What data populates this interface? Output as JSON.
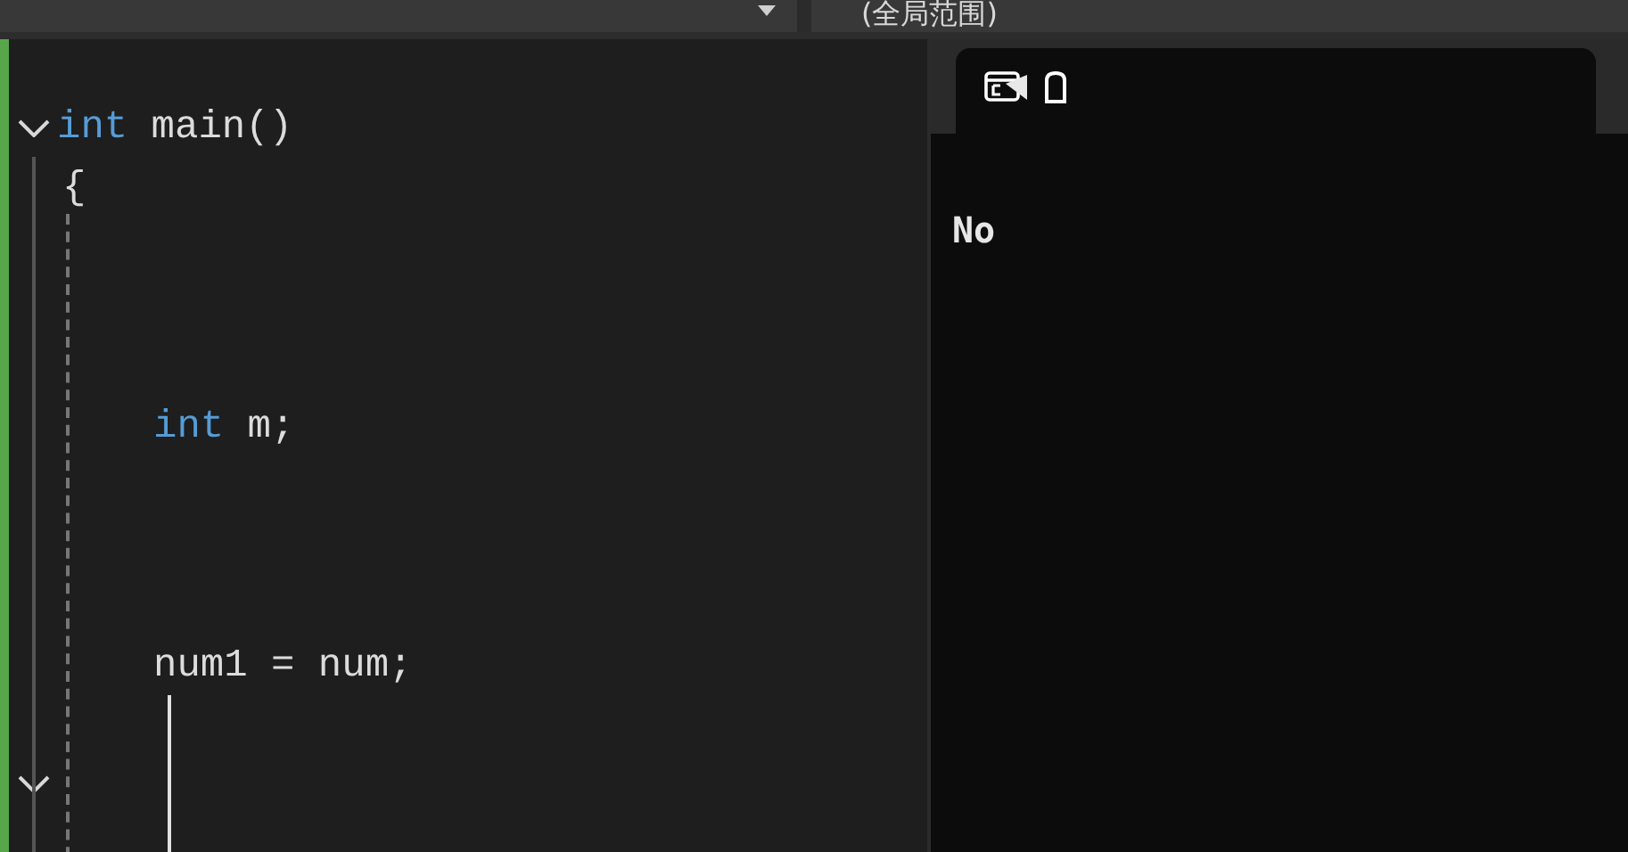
{
  "top_bar": {
    "scope_label": "(全局范围)"
  },
  "editor": {
    "lines": [
      {
        "fold": true,
        "tokens": [
          {
            "kind": "keyword",
            "text": "int"
          },
          {
            "kind": "plain",
            "text": " main()"
          }
        ]
      },
      {
        "fold": false,
        "tokens": [
          {
            "kind": "brace",
            "text": "{"
          }
        ]
      },
      {
        "fold": false
      },
      {
        "fold": false
      },
      {
        "fold": false
      },
      {
        "fold": false,
        "tokens": [
          {
            "kind": "keyword",
            "text": "int"
          },
          {
            "kind": "plain",
            "text": " m;"
          }
        ]
      },
      {
        "fold": false
      },
      {
        "fold": false
      },
      {
        "fold": false
      },
      {
        "fold": false,
        "tokens": [
          {
            "kind": "plain",
            "text": "num1 = num;"
          }
        ]
      },
      {
        "fold": false
      },
      {
        "fold": true
      },
      {
        "fold": false
      }
    ]
  },
  "console": {
    "output": "No"
  }
}
